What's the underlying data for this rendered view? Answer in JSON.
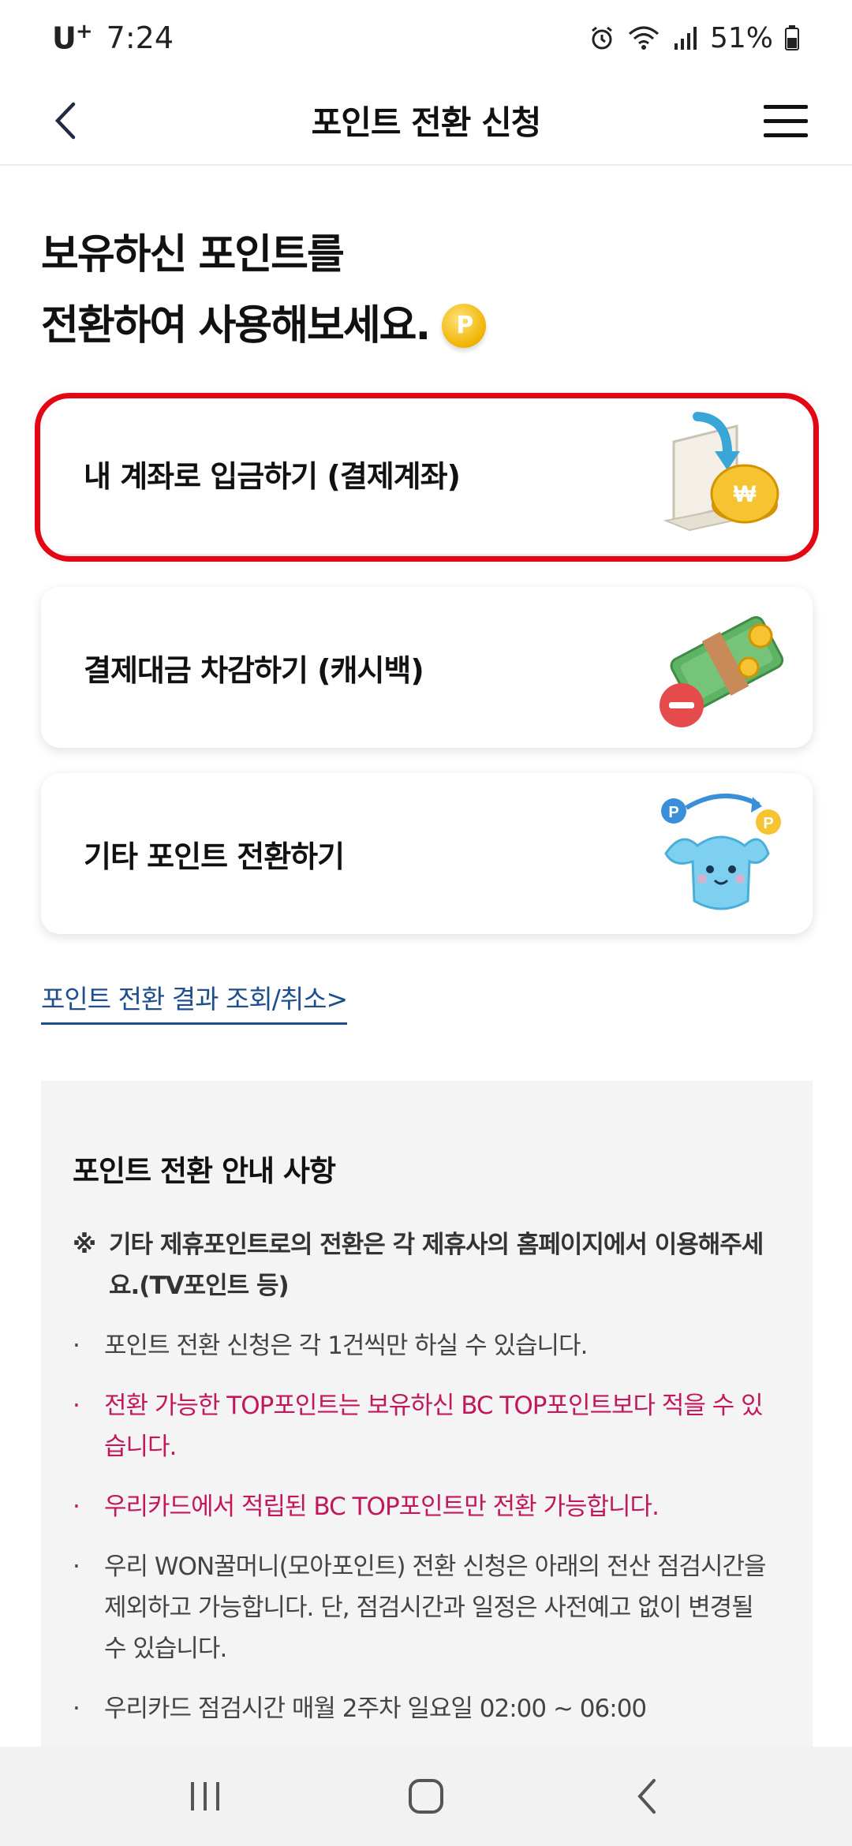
{
  "status_bar": {
    "carrier": "U",
    "carrier_sup": "+",
    "time": "7:24",
    "battery": "51%"
  },
  "header": {
    "title": "포인트 전환 신청"
  },
  "headline": {
    "line1": "보유하신 포인트를",
    "line2": "전환하여 사용해보세요.",
    "coin_label": "P"
  },
  "options": [
    {
      "label": "내 계좌로 입금하기 (결제계좌)",
      "icon": "laptop-coin-icon"
    },
    {
      "label": "결제대금 차감하기 (캐시백)",
      "icon": "money-minus-icon"
    },
    {
      "label": "기타 포인트 전환하기",
      "icon": "character-exchange-icon"
    }
  ],
  "link": {
    "label": "포인트 전환 결과 조회/취소>"
  },
  "notice": {
    "title": "포인트 전환 안내 사항",
    "items": [
      {
        "bullet": "※",
        "text": "기타 제휴포인트로의 전환은 각 제휴사의 홈페이지에서 이용해주세요.(TV포인트 등)"
      },
      {
        "bullet": "·",
        "text": "포인트 전환 신청은 각 1건씩만 하실 수 있습니다."
      },
      {
        "bullet": "·",
        "text": "전환 가능한 TOP포인트는 보유하신 BC TOP포인트보다 적을 수 있습니다."
      },
      {
        "bullet": "·",
        "text": "우리카드에서 적립된 BC TOP포인트만 전환 가능합니다."
      },
      {
        "bullet": "·",
        "text": "우리 WON꿀머니(모아포인트) 전환 신청은 아래의 전산 점검시간을 제외하고 가능합니다. 단, 점검시간과 일정은 사전예고 없이 변경될 수 있습니다."
      },
      {
        "bullet": "·",
        "text": "우리카드 점검시간 매월 2주차 일요일 02:00 ~ 06:00"
      }
    ]
  },
  "colors": {
    "highlight": "#e30613",
    "link": "#1f4e8c",
    "pink": "#c2185b"
  }
}
